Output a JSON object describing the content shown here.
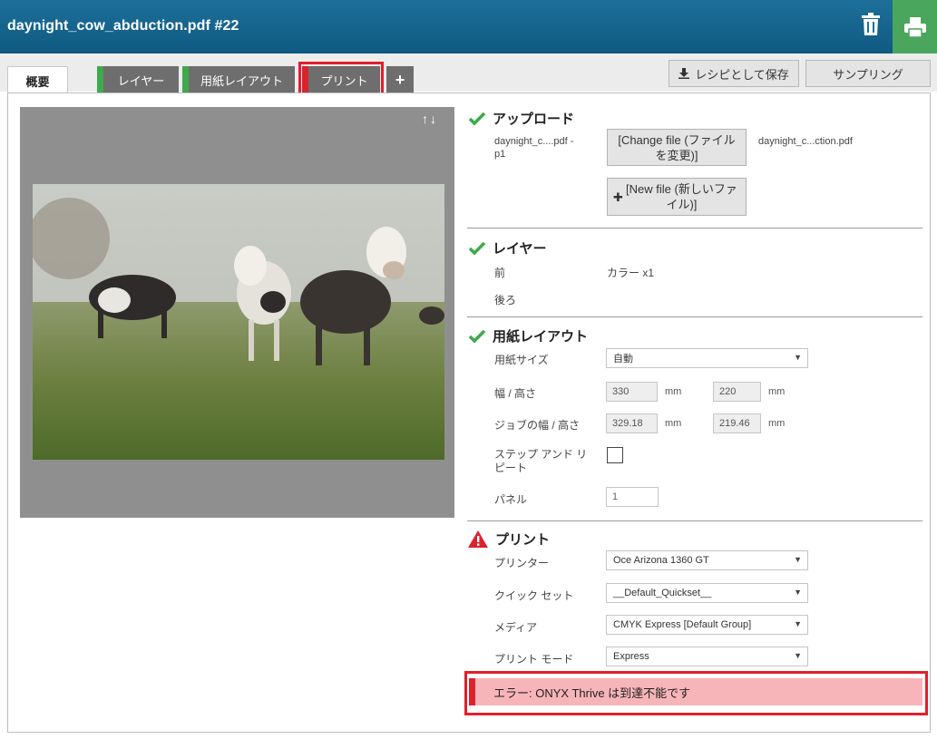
{
  "header": {
    "title": "daynight_cow_abduction.pdf #22",
    "trash_icon": "trash-icon",
    "print_icon": "printer-icon",
    "print_bg": "#4aa65d"
  },
  "tabs": {
    "summary": "概要",
    "layer": "レイヤー",
    "paper_layout": "用紙レイアウト",
    "print": "プリント",
    "add": "+"
  },
  "toolbar": {
    "save_recipe": "レシピとして保存",
    "sampling": "サンプリング"
  },
  "preview": {
    "arrows": "↑↓"
  },
  "upload": {
    "title": "アップロード",
    "file_short_1": "daynight_c....pdf -",
    "file_short_2": "p1",
    "change_file": "[Change file (ファイルを変更)]",
    "new_file": "[New file (新しいファイル)]",
    "file_name": "daynight_c...ction.pdf"
  },
  "layer": {
    "title": "レイヤー",
    "front_label": "前",
    "front_value": "カラー x1",
    "back_label": "後ろ"
  },
  "paper_layout": {
    "title": "用紙レイアウト",
    "paper_size_label": "用紙サイズ",
    "paper_size_value": "自動",
    "wh_label": "幅 / 高さ",
    "width": "330",
    "height": "220",
    "unit": "mm",
    "job_wh_label": "ジョブの幅 / 高さ",
    "job_width": "329.18",
    "job_height": "219.46",
    "step_repeat_label_1": "ステップ アンド リ",
    "step_repeat_label_2": "ピート",
    "panel_label": "パネル",
    "panel_value": "1"
  },
  "print": {
    "title": "プリント",
    "printer_label": "プリンター",
    "printer_value": "Oce Arizona 1360 GT",
    "quickset_label": "クイック セット",
    "quickset_value": "__Default_Quickset__",
    "media_label": "メディア",
    "media_value": "CMYK Express [Default Group]",
    "mode_label": "プリント モード",
    "mode_value": "Express"
  },
  "error": {
    "message": "エラー: ONYX Thrive は到達不能です"
  },
  "colors": {
    "accent_green": "#3daa4b",
    "accent_red": "#d9232e",
    "header_blue": "#0f5a82"
  }
}
